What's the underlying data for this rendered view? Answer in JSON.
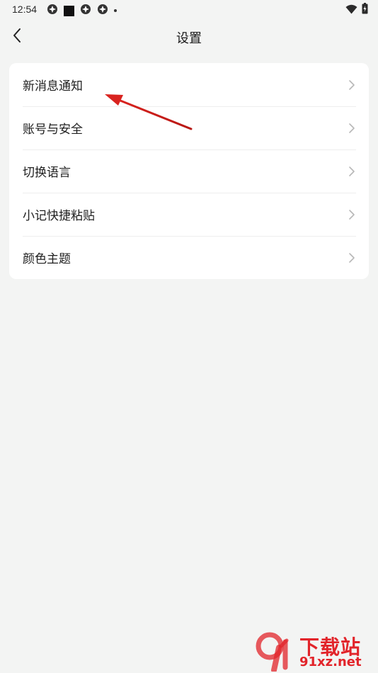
{
  "status_bar": {
    "time": "12:54",
    "left_icons": [
      "notification-icon",
      "notification-icon",
      "stop-icon",
      "notification-icon",
      "notification-icon",
      "dot-icon"
    ],
    "right_icons": [
      "wifi-icon",
      "battery-icon"
    ]
  },
  "header": {
    "title": "设置",
    "back_icon": "chevron-left-icon"
  },
  "settings": {
    "items": [
      {
        "label": "新消息通知"
      },
      {
        "label": "账号与安全"
      },
      {
        "label": "切换语言"
      },
      {
        "label": "小记快捷粘贴"
      },
      {
        "label": "颜色主题"
      }
    ]
  },
  "annotation": {
    "color": "#d9231f"
  },
  "watermark": {
    "title": "下载站",
    "url": "91xz.net",
    "color": "#e2242a"
  }
}
